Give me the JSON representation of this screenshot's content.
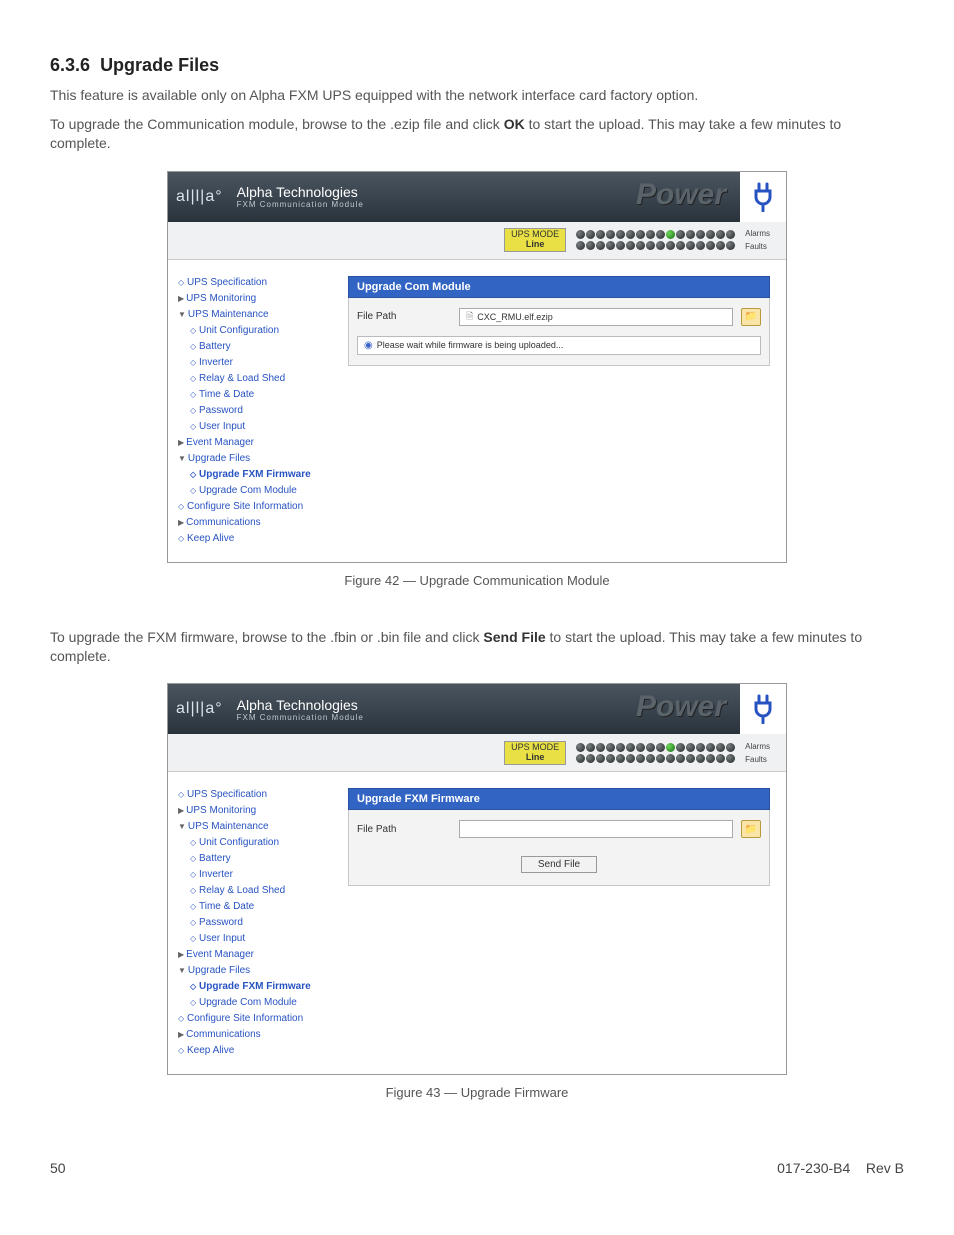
{
  "section": {
    "number": "6.3.6",
    "title": "Upgrade Files"
  },
  "paragraphs": {
    "intro": "This feature is available only on Alpha FXM UPS equipped with the network interface card factory option.",
    "upgrade_com_pre": "To upgrade the Communication module, browse to the .ezip file and click ",
    "upgrade_com_ok": "OK",
    "upgrade_com_post": " to start the upload. This may take a few minutes to complete.",
    "upgrade_fxm_pre": "To upgrade the FXM firmware, browse to the .fbin or .bin file and click ",
    "upgrade_fxm_btn": "Send File",
    "upgrade_fxm_post": " to start the upload. This may take a few minutes to complete."
  },
  "captions": {
    "fig42": "Figure 42  —  Upgrade Communication Module",
    "fig43": "Figure 43  —  Upgrade Firmware"
  },
  "screenshot_common": {
    "brand": "Alpha Technologies",
    "subtitle": "FXM Communication Module",
    "power_word": "Power",
    "ups_mode_label": "UPS MODE",
    "ups_mode_value": "Line",
    "alarms_label": "Alarms",
    "faults_label": "Faults",
    "nav": {
      "ups_spec": "UPS Specification",
      "ups_monitoring": "UPS Monitoring",
      "ups_maintenance": "UPS Maintenance",
      "unit_config": "Unit Configuration",
      "battery": "Battery",
      "inverter": "Inverter",
      "relay": "Relay & Load Shed",
      "time_date": "Time & Date",
      "password": "Password",
      "user_input": "User Input",
      "event_manager": "Event Manager",
      "upgrade_files": "Upgrade Files",
      "upgrade_fxm": "Upgrade FXM Firmware",
      "upgrade_com": "Upgrade Com Module",
      "config_site": "Configure Site Information",
      "communications": "Communications",
      "keep_alive": "Keep Alive"
    }
  },
  "fig42_panel": {
    "title": "Upgrade Com Module",
    "file_path_label": "File Path",
    "file_value": "CXC_RMU.elf.ezip",
    "status_text": "Please wait while firmware is being uploaded..."
  },
  "fig43_panel": {
    "title": "Upgrade FXM Firmware",
    "file_path_label": "File Path",
    "file_value": "",
    "send_file_label": "Send File"
  },
  "footer": {
    "page": "50",
    "doc": "017-230-B4",
    "rev": "Rev B"
  }
}
